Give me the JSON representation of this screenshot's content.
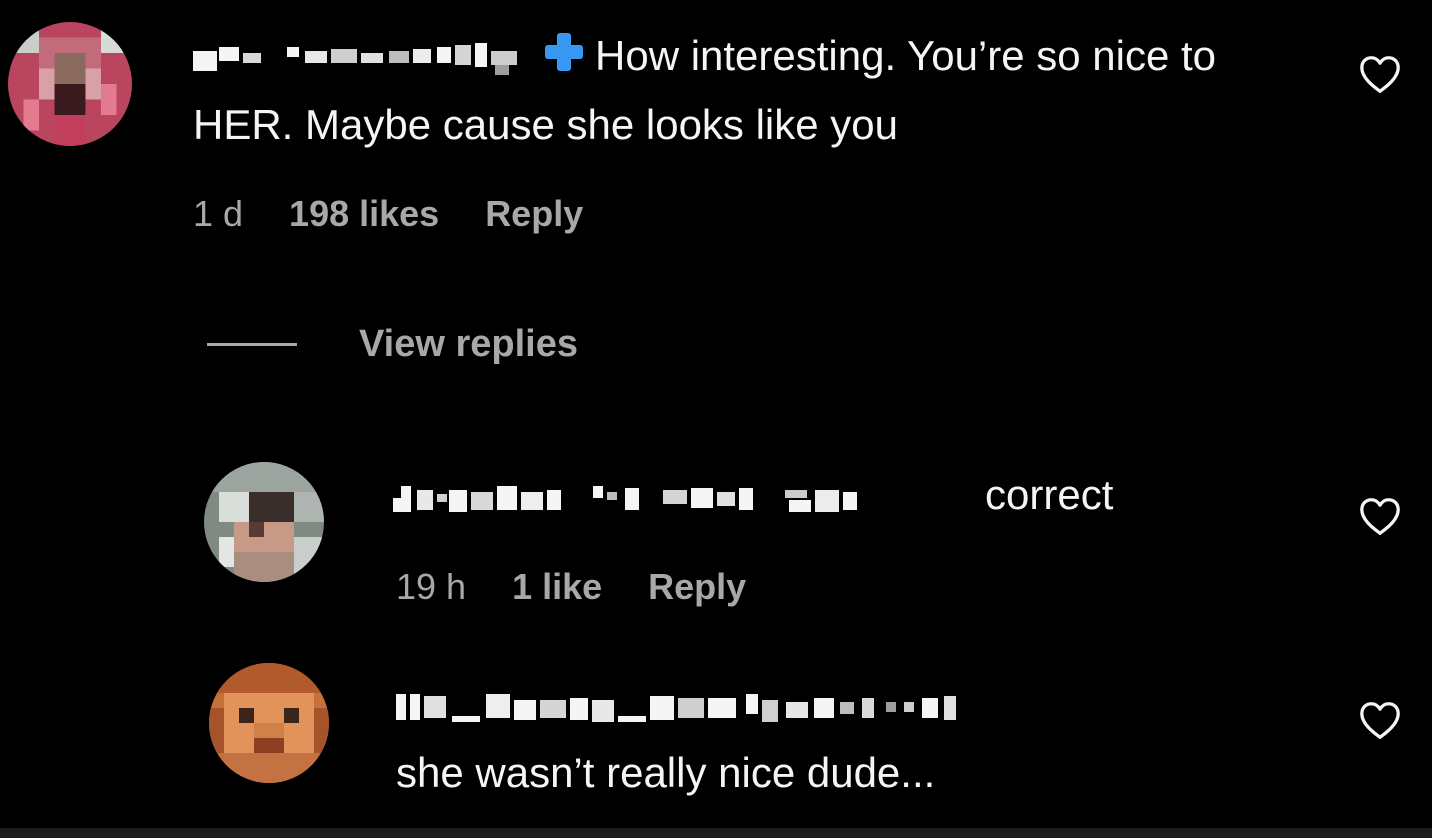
{
  "comments": [
    {
      "text": "How interesting. You’re so nice to HER. Maybe cause she looks like you",
      "time": "1 d",
      "likes": "198 likes",
      "reply_label": "Reply",
      "like_icon": "heart-outline-icon",
      "verified_icon": "blue-plus-icon"
    }
  ],
  "view_replies_label": "View replies",
  "replies": [
    {
      "text": "correct",
      "time": "19 h",
      "likes": "1 like",
      "reply_label": "Reply",
      "like_icon": "heart-outline-icon"
    },
    {
      "text": "she wasn’t really nice dude...",
      "like_icon": "heart-outline-icon"
    }
  ],
  "colors": {
    "background": "#000000",
    "text": "#f5f5f5",
    "muted": "#a8a8a8",
    "accent": "#3897f0"
  }
}
